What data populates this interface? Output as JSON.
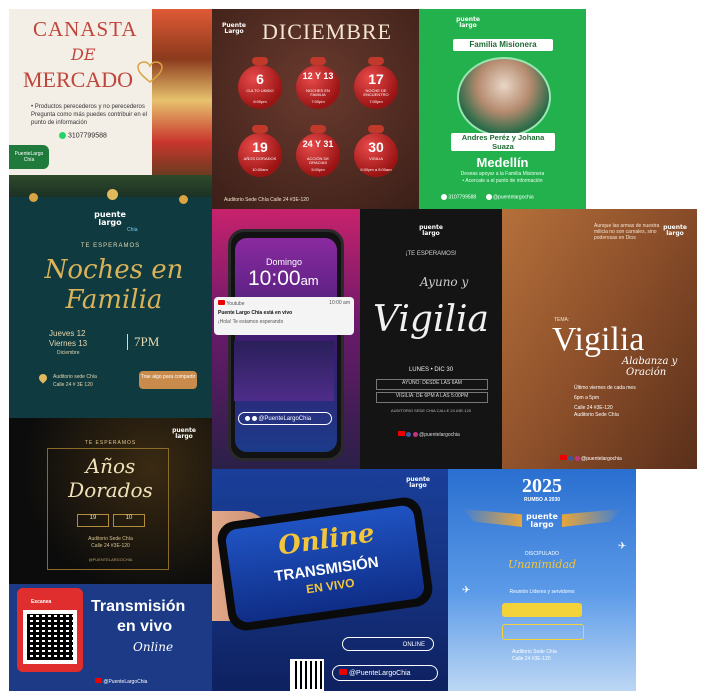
{
  "colors": {
    "background": "#3b3a78",
    "green": "#23b14d",
    "red": "#d62828",
    "gold": "#c9a14a",
    "blue": "#1b3c8f"
  },
  "tiles": {
    "canasta": {
      "title_l1": "CANASTA",
      "title_l2": "DE",
      "title_l3": "MERCADO",
      "bullet1": "• Productos perecederos y no perecederos",
      "bullet2": "Pregunta como más puedes contribuir en el punto de información",
      "phone": "3107799588",
      "logo": "PuenteLargo Chía"
    },
    "diciembre": {
      "title": "DICIEMBRE",
      "logo": "Puente Largo",
      "events": [
        {
          "day": "6",
          "label": "CULTO UNIDO",
          "time": "6:00pm"
        },
        {
          "day": "12 Y 13",
          "label": "NOCHES EN FAMILIA",
          "time": "7:00pm"
        },
        {
          "day": "17",
          "label": "NOCHE DE ENCUENTRO",
          "time": "7:00pm"
        },
        {
          "day": "19",
          "label": "AÑOS DORADOS",
          "time": "10:00am"
        },
        {
          "day": "24 Y 31",
          "label": "ACCIÓN DE GRACIAS",
          "time": "5:00pm"
        },
        {
          "day": "30",
          "label": "VIGILIA",
          "time": "6:00pm a 5:00am"
        }
      ],
      "address": "Auditorio Sede Chía",
      "street": "Calle 24 #3E-120"
    },
    "familia": {
      "badge": "Familia Misionera",
      "names": "Andres Peréz y Johana Suaza",
      "city": "Medellín",
      "note": "Deseas apoyar a la Familia Misionera",
      "note2": "• Acercate a el punto de información",
      "phone": "3107799588",
      "social": "@puentelargochia",
      "logo": "puente largo"
    },
    "noches": {
      "logo": "puente largo",
      "logo_sub": "Chía",
      "te_esperamos": "TE ESPERAMOS",
      "title_l1": "Noches en",
      "title_l2": "Familia",
      "date_l1": "Jueves 12",
      "date_l2": "Viernes 13",
      "date_l3": "Diciembre",
      "time": "7PM",
      "place": "Auditorio sede Chía",
      "street": "Calle 24 # 3E 120",
      "cta": "Trae algo para compartir"
    },
    "live_phone": {
      "day": "Domingo",
      "time": "10:00",
      "time_suffix": "am",
      "app": "Youtube",
      "app_time": "10:00 am",
      "notice_title": "Puente Largo Chía está en vivo",
      "notice_body": "¡Hola! Te estamos esperando",
      "handle": "@PuenteLargoChia"
    },
    "vigilia1": {
      "logo": "puente largo",
      "te_esperamos": "¡TE ESPERAMOS!",
      "script": "Ayuno y",
      "title": "Vigilia",
      "date": "LUNES • DIC 30",
      "row1": "AYUNO: DESDE LAS 6AM",
      "row2": "VIGILIA: DE 6PM A LAS 5:00PM",
      "address": "AUDITORIO SEDE CHIA CALLE 24 #3E-120",
      "social": "@puentelargochia"
    },
    "vigilia2": {
      "logo": "puente largo",
      "quote": "Aunque las armas de nuestra milicia no son carnales, sino poderosas en Dios",
      "tema": "TEMA:",
      "title": "Vigilia",
      "subtitle_l1": "Alabanza y",
      "subtitle_l2": "Oración",
      "row1": "Último viernes de cada mes",
      "row2": "6pm a 5pm",
      "row3": "Calle 24 #3E-120",
      "row4": "Auditorio Sede Chía",
      "social": "@puentelargochia"
    },
    "anos": {
      "logo": "puente largo",
      "te_esperamos": "TE ESPERAMOS",
      "title_l1": "Años",
      "title_l2": "Dorados",
      "d1": "19",
      "d2": "10",
      "place": "Auditorio Sede Chía",
      "street": "Calle 24 #3E-120",
      "social": "@PUENTELARGOCHIA"
    },
    "online": {
      "logo": "puente largo",
      "title": "Online",
      "sub_l1": "TRANSMISIÓN",
      "sub_l2": "EN VIVO",
      "badge": "ONLINE",
      "handle": "@PuenteLargoChia"
    },
    "rumbo": {
      "year": "2025",
      "sub": "RUMBO A 2030",
      "logo": "puente largo",
      "tagline_l1": "DISCIPULADO",
      "tagline_l2": "Unanimidad",
      "meeting": "Reunión Líderes y servidores",
      "place": "Auditorio Sede Chía",
      "street": "Calle 24 #3E-120"
    },
    "transmision": {
      "scan": "Escanea",
      "title_l1": "Transmisión",
      "title_l2": "en vivo",
      "script": "Online",
      "handle": "@PuenteLargoChia"
    }
  }
}
